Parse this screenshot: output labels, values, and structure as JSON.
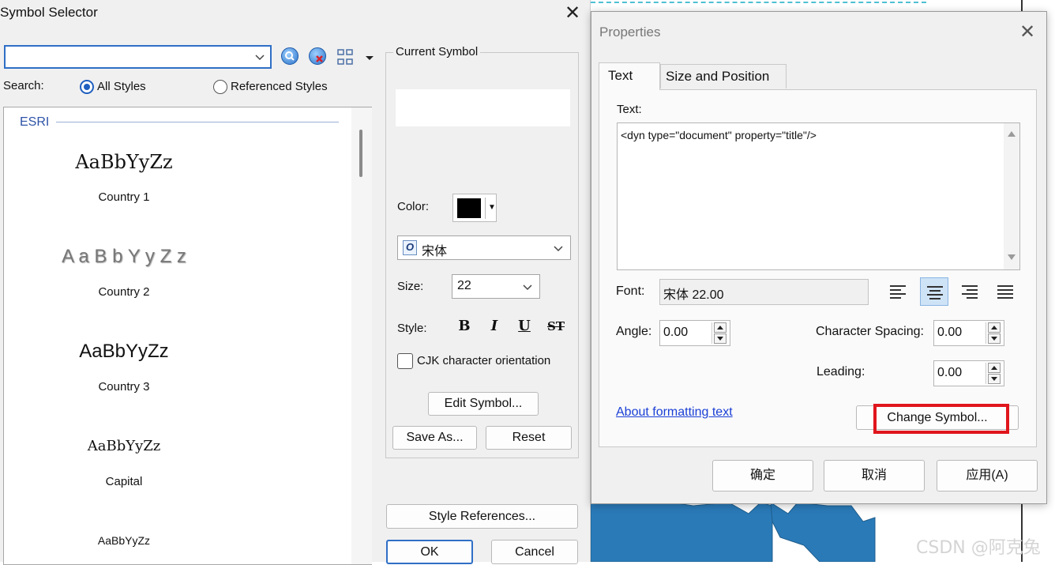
{
  "symbol_selector": {
    "title": "Symbol Selector",
    "search_value": "",
    "search_label": "Search:",
    "radio_all": "All Styles",
    "radio_referenced": "Referenced Styles",
    "group_name": "ESRI",
    "symbols": [
      {
        "sample": "AaBbYyZz",
        "name": "Country 1"
      },
      {
        "sample": "A a B b Y y Z z",
        "name": "Country 2"
      },
      {
        "sample": "AaBbYyZz",
        "name": "Country 3"
      },
      {
        "sample": "AaBbYyZz",
        "name": "Capital"
      },
      {
        "sample": "AaBbYyZz",
        "name": ""
      }
    ],
    "current_symbol_label": "Current Symbol",
    "color_label": "Color:",
    "font_value": "宋体",
    "size_label": "Size:",
    "size_value": "22",
    "style_label": "Style:",
    "style_buttons": [
      "B",
      "I",
      "U",
      "ST"
    ],
    "cjk_label": "CJK character orientation",
    "edit_symbol_label": "Edit Symbol...",
    "save_as_label": "Save As...",
    "reset_label": "Reset",
    "style_references_label": "Style References...",
    "ok_label": "OK",
    "cancel_label": "Cancel",
    "color_value": "#000000"
  },
  "properties": {
    "title": "Properties",
    "tabs": [
      "Text",
      "Size and Position"
    ],
    "text_label": "Text:",
    "text_value": "<dyn type=\"document\" property=\"title\"/>",
    "font_label": "Font:",
    "font_value": "宋体 22.00",
    "angle_label": "Angle:",
    "angle_value": "0.00",
    "char_spacing_label": "Character Spacing:",
    "char_spacing_value": "0.00",
    "leading_label": "Leading:",
    "leading_value": "0.00",
    "about_link": "About formatting text",
    "change_symbol_label": "Change Symbol...",
    "confirm_label": "确定",
    "cancel_label": "取消",
    "apply_label": "应用(A)",
    "highlight_color": "#e0161d"
  },
  "watermark": "CSDN @阿克兔",
  "map_fill_color": "#2a7ab8"
}
